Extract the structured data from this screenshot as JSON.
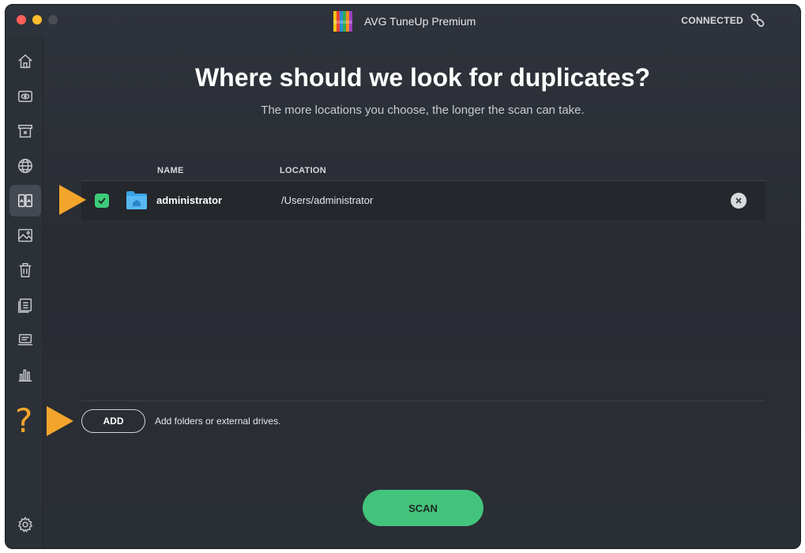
{
  "app": {
    "title": "AVG TuneUp Premium",
    "status": "CONNECTED"
  },
  "sidebar": {
    "items": [
      {
        "icon": "home-icon"
      },
      {
        "icon": "disk-eye-icon"
      },
      {
        "icon": "archive-box-icon"
      },
      {
        "icon": "globe-icon"
      },
      {
        "icon": "duplicates-icon",
        "active": true
      },
      {
        "icon": "photo-icon"
      },
      {
        "icon": "trash-icon"
      },
      {
        "icon": "list-doc-icon"
      },
      {
        "icon": "laptop-icon"
      },
      {
        "icon": "bar-chart-icon"
      }
    ],
    "help": "?",
    "settings_icon": "gear-icon"
  },
  "main": {
    "heading": "Where should we look for duplicates?",
    "subheading": "The more locations you choose, the longer the scan can take.",
    "columns": {
      "name": "NAME",
      "location": "LOCATION"
    },
    "locations": [
      {
        "checked": true,
        "name": "administrator",
        "path": "/Users/administrator"
      }
    ],
    "add_label": "ADD",
    "add_hint": "Add folders or external drives.",
    "scan_label": "SCAN"
  },
  "colors": {
    "accent_green": "#43c47c",
    "highlight_orange": "#f3a52b",
    "background": "#2c3037"
  }
}
